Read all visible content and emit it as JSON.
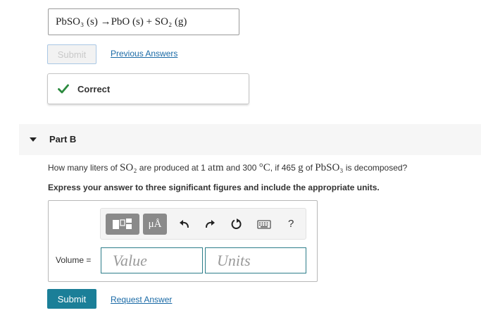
{
  "partA": {
    "answer_html": "PbSO₃ (s) →PbO (s) + SO₂ (g)",
    "submit_label": "Submit",
    "previous_answers_label": "Previous Answers",
    "correct_label": "Correct"
  },
  "partB": {
    "title": "Part B",
    "question": {
      "pre": "How many liters of ",
      "so2": "SO₂",
      "mid1": " are produced at 1 ",
      "atm": "atm",
      "mid2": " and 300 ",
      "degc": "°C",
      "mid3": ", if 465 ",
      "g": " g",
      "mid4": " of ",
      "pbso3": "PbSO₃",
      "post": " is decomposed?"
    },
    "instruction": "Express your answer to three significant figures and include the appropriate units.",
    "unit_button_label": "μÅ",
    "help_label": "?",
    "volume_label": "Volume =",
    "value_placeholder": "Value",
    "units_placeholder": "Units",
    "submit_label": "Submit",
    "request_answer_label": "Request Answer"
  },
  "colors": {
    "link": "#1a6aa6",
    "submit_bg": "#1b7f98",
    "check": "#2b8a3e",
    "field_border": "#2d7e8a"
  }
}
